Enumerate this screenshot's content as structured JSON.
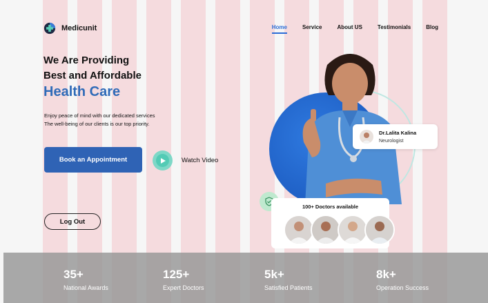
{
  "brand": {
    "name": "Medicunit"
  },
  "nav": {
    "items": [
      {
        "label": "Home",
        "active": true
      },
      {
        "label": "Service"
      },
      {
        "label": "About US"
      },
      {
        "label": "Testimonials"
      },
      {
        "label": "Blog"
      }
    ]
  },
  "hero": {
    "title_line1": "We Are Providing",
    "title_line2": "Best and Affordable",
    "title_accent": "Health Care",
    "desc_line1": "Enjoy peace of mind with our dedicated services",
    "desc_line2": "The well-being of our clients is our top priority.",
    "cta_label": "Book an Appointment",
    "watch_label": "Watch Video",
    "logout_label": "Log Out"
  },
  "doctor_card": {
    "name": "Dr.Lalita Kalina",
    "role": "Neurologist"
  },
  "doctors_available": {
    "title": "100+ Doctors available"
  },
  "stats": [
    {
      "value": "35+",
      "label": "National  Awards"
    },
    {
      "value": "125+",
      "label": "Expert Doctors"
    },
    {
      "value": "5k+",
      "label": "Satisfied Patients"
    },
    {
      "value": "8k+",
      "label": "Operation Success"
    }
  ],
  "colors": {
    "primary": "#2f63b5",
    "accent_text": "#2f6bb8",
    "teal": "#53cbb5"
  }
}
